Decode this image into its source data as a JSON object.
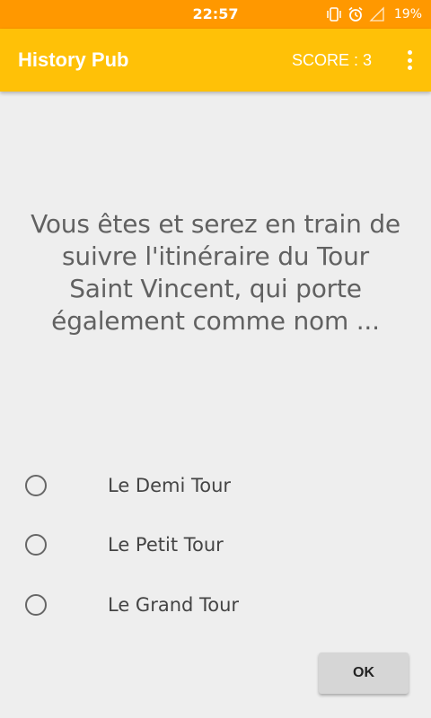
{
  "status_bar": {
    "time": "22:57",
    "battery": "19%",
    "icons": [
      "vibrate-icon",
      "alarm-icon",
      "signal-icon",
      "battery-icon"
    ],
    "color": "#ff9800"
  },
  "app_bar": {
    "title": "History Pub",
    "score": "SCORE : 3",
    "menu_icon": "more-vert-icon",
    "color": "#ffc107"
  },
  "question": {
    "text": "Vous êtes et serez en train de suivre l'itinéraire du Tour Saint Vincent, qui porte également comme nom ..."
  },
  "options": [
    {
      "label": "Le Demi Tour",
      "selected": false
    },
    {
      "label": "Le Petit Tour",
      "selected": false
    },
    {
      "label": "Le Grand Tour",
      "selected": false
    }
  ],
  "actions": {
    "ok_label": "OK"
  }
}
